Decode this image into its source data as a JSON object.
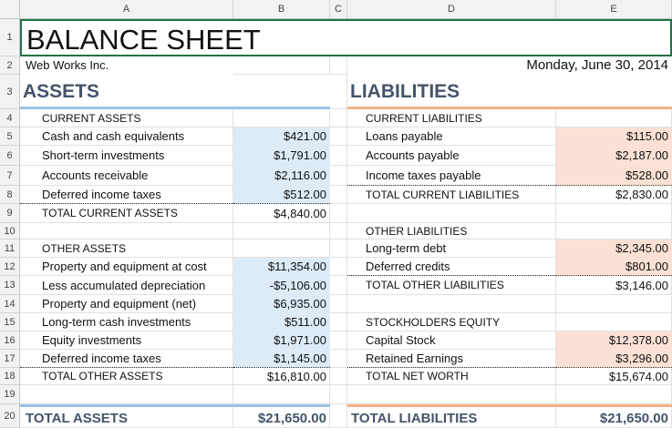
{
  "columns": [
    "A",
    "B",
    "C",
    "D",
    "E"
  ],
  "rows": [
    "1",
    "2",
    "3",
    "4",
    "5",
    "6",
    "7",
    "8",
    "9",
    "10",
    "11",
    "12",
    "13",
    "14",
    "15",
    "16",
    "17",
    "18",
    "19",
    "20"
  ],
  "title": "BALANCE SHEET",
  "company": "Web Works Inc.",
  "date": "Monday, June 30, 2014",
  "assets": {
    "heading": "ASSETS",
    "current_heading": "CURRENT ASSETS",
    "current": [
      {
        "label": "Cash and cash equivalents",
        "value": "$421.00"
      },
      {
        "label": "Short-term investments",
        "value": "$1,791.00"
      },
      {
        "label": "Accounts receivable",
        "value": "$2,116.00"
      },
      {
        "label": "Deferred income taxes",
        "value": "$512.00"
      }
    ],
    "total_current_label": "TOTAL CURRENT ASSETS",
    "total_current_value": "$4,840.00",
    "other_heading": "OTHER ASSETS",
    "other": [
      {
        "label": "Property and equipment at cost",
        "value": "$11,354.00"
      },
      {
        "label": "Less accumulated depreciation",
        "value": "-$5,106.00"
      },
      {
        "label": "Property and equipment (net)",
        "value": "$6,935.00"
      },
      {
        "label": "Long-term cash investments",
        "value": "$511.00"
      },
      {
        "label": "Equity investments",
        "value": "$1,971.00"
      },
      {
        "label": "Deferred income taxes",
        "value": "$1,145.00"
      }
    ],
    "total_other_label": "TOTAL OTHER ASSETS",
    "total_other_value": "$16,810.00",
    "total_label": "TOTAL ASSETS",
    "total_value": "$21,650.00"
  },
  "liabilities": {
    "heading": "LIABILITIES",
    "current_heading": "CURRENT LIABILITIES",
    "current": [
      {
        "label": "Loans payable",
        "value": "$115.00"
      },
      {
        "label": "Accounts payable",
        "value": "$2,187.00"
      },
      {
        "label": "Income taxes payable",
        "value": "$528.00"
      }
    ],
    "total_current_label": "TOTAL CURRENT LIABILITIES",
    "total_current_value": "$2,830.00",
    "other_heading": "OTHER LIABILITIES",
    "other": [
      {
        "label": "Long-term debt",
        "value": "$2,345.00"
      },
      {
        "label": "Deferred credits",
        "value": "$801.00"
      }
    ],
    "total_other_label": "TOTAL OTHER LIABILITIES",
    "total_other_value": "$3,146.00",
    "equity_heading": "STOCKHOLDERS EQUITY",
    "equity": [
      {
        "label": "Capital Stock",
        "value": "$12,378.00"
      },
      {
        "label": "Retained Earnings",
        "value": "$3,296.00"
      }
    ],
    "net_worth_label": "TOTAL NET WORTH",
    "net_worth_value": "$15,674.00",
    "total_label": "TOTAL LIABILITIES",
    "total_value": "$21,650.00"
  },
  "colors": {
    "asset_fill": "#ddebf7",
    "liability_fill": "#fbe1d5",
    "asset_rule": "#9bc2e6",
    "liability_rule": "#f4b183",
    "heading": "#44546a",
    "selection": "#217346"
  }
}
